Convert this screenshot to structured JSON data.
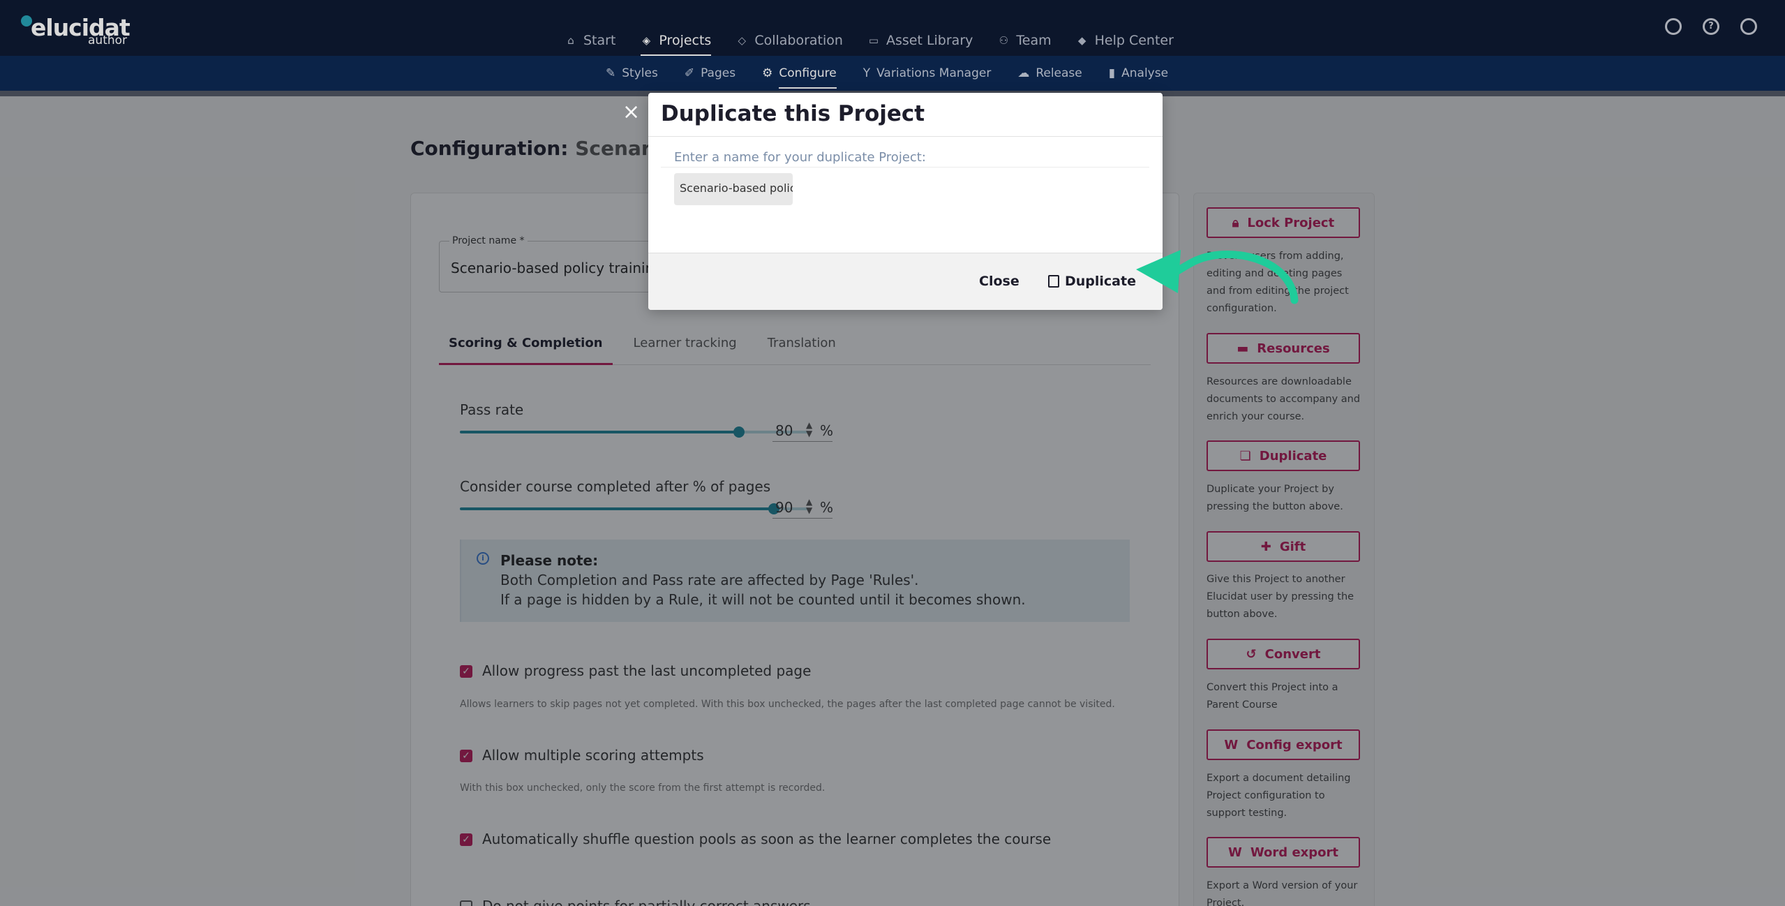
{
  "brand": {
    "name": "elucidat",
    "sub": "author"
  },
  "main_nav": [
    {
      "label": "Start",
      "icon": "home-icon"
    },
    {
      "label": "Projects",
      "icon": "layers-icon",
      "active": true
    },
    {
      "label": "Collaboration",
      "icon": "comment-icon"
    },
    {
      "label": "Asset Library",
      "icon": "image-icon"
    },
    {
      "label": "Team",
      "icon": "users-icon"
    },
    {
      "label": "Help Center",
      "icon": "graduation-icon"
    }
  ],
  "sub_nav": [
    {
      "label": "Styles",
      "icon": "brush-icon"
    },
    {
      "label": "Pages",
      "icon": "pencil-icon"
    },
    {
      "label": "Configure",
      "icon": "gear-icon",
      "active": true
    },
    {
      "label": "Variations Manager",
      "icon": "branch-icon"
    },
    {
      "label": "Release",
      "icon": "cloud-icon"
    },
    {
      "label": "Analyse",
      "icon": "bar-chart-icon"
    }
  ],
  "page": {
    "title_prefix": "Configuration:",
    "title_project": "Scenario-"
  },
  "project_name": {
    "label": "Project name *",
    "value": "Scenario-based policy training"
  },
  "tabs": [
    "Scoring & Completion",
    "Learner tracking",
    "Translation"
  ],
  "pass_rate": {
    "label": "Pass rate",
    "value": "80",
    "unit": "%",
    "fraction": 0.8
  },
  "completion": {
    "label": "Consider course completed after % of pages",
    "value": "90",
    "unit": "%",
    "fraction": 0.9
  },
  "note": {
    "title": "Please note:",
    "line1": "Both Completion and Pass rate are affected by Page 'Rules'.",
    "line2": "If a page is hidden by a Rule, it will not be counted until it becomes shown."
  },
  "options": [
    {
      "label": "Allow progress past the last uncompleted page",
      "help": "Allows learners to skip pages not yet completed. With this box unchecked, the pages after the last completed page cannot be visited.",
      "checked": true
    },
    {
      "label": "Allow multiple scoring attempts",
      "help": "With this box unchecked, only the score from the first attempt is recorded.",
      "checked": true
    },
    {
      "label": "Automatically shuffle question pools as soon as the learner completes the course",
      "help": "",
      "checked": true
    },
    {
      "label": "Do not give points for partially correct answers",
      "help": "",
      "checked": false
    }
  ],
  "side_actions": [
    {
      "label": "Lock Project",
      "icon": "lock-icon",
      "desc": "Prevent users from adding, editing and deleting pages and from editing the project configuration."
    },
    {
      "label": "Resources",
      "icon": "folder-icon",
      "desc": "Resources are downloadable documents to accompany and enrich your course."
    },
    {
      "label": "Duplicate",
      "icon": "copy-icon",
      "desc": "Duplicate your Project by pressing the button above."
    },
    {
      "label": "Gift",
      "icon": "gift-icon",
      "desc": "Give this Project to another Elucidat user by pressing the button above."
    },
    {
      "label": "Convert",
      "icon": "undo-icon",
      "desc": "Convert this Project into a Parent Course"
    },
    {
      "label": "Config export",
      "icon": "word-doc-icon",
      "desc": "Export a document detailing Project configuration to support testing."
    },
    {
      "label": "Word export",
      "icon": "word-doc-icon",
      "desc": "Export a Word version of your Project."
    }
  ],
  "modal": {
    "title": "Duplicate this Project",
    "prompt": "Enter a name for your duplicate Project:",
    "input_value": "Scenario-based policy tra",
    "close_label": "Close",
    "duplicate_label": "Duplicate"
  },
  "colors": {
    "brand_accent": "#c2185b",
    "nav_bg": "#0f1b33",
    "subnav_bg": "#0d2a55",
    "slider": "#1d8ba0",
    "annotation_arrow": "#1fcc9a"
  }
}
